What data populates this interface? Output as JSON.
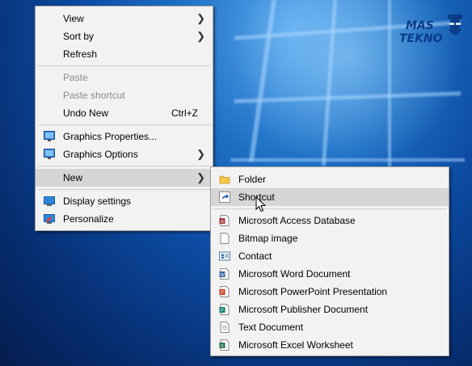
{
  "desktop": {
    "watermark_line1": "MAS",
    "watermark_line2": "TEKNO"
  },
  "context_menu": {
    "view": "View",
    "sort_by": "Sort by",
    "refresh": "Refresh",
    "paste": "Paste",
    "paste_shortcut": "Paste shortcut",
    "undo_new": "Undo New",
    "undo_shortcut": "Ctrl+Z",
    "graphics_properties": "Graphics Properties...",
    "graphics_options": "Graphics Options",
    "new": "New",
    "display_settings": "Display settings",
    "personalize": "Personalize"
  },
  "new_submenu": {
    "folder": "Folder",
    "shortcut": "Shortcut",
    "access": "Microsoft Access Database",
    "bitmap": "Bitmap image",
    "contact": "Contact",
    "word": "Microsoft Word Document",
    "powerpoint": "Microsoft PowerPoint Presentation",
    "publisher": "Microsoft Publisher Document",
    "text": "Text Document",
    "excel": "Microsoft Excel Worksheet"
  },
  "colors": {
    "menu_bg": "#f2f2f2",
    "highlight": "#d6d6d6",
    "desktop_blue": "#0c4aa0"
  }
}
